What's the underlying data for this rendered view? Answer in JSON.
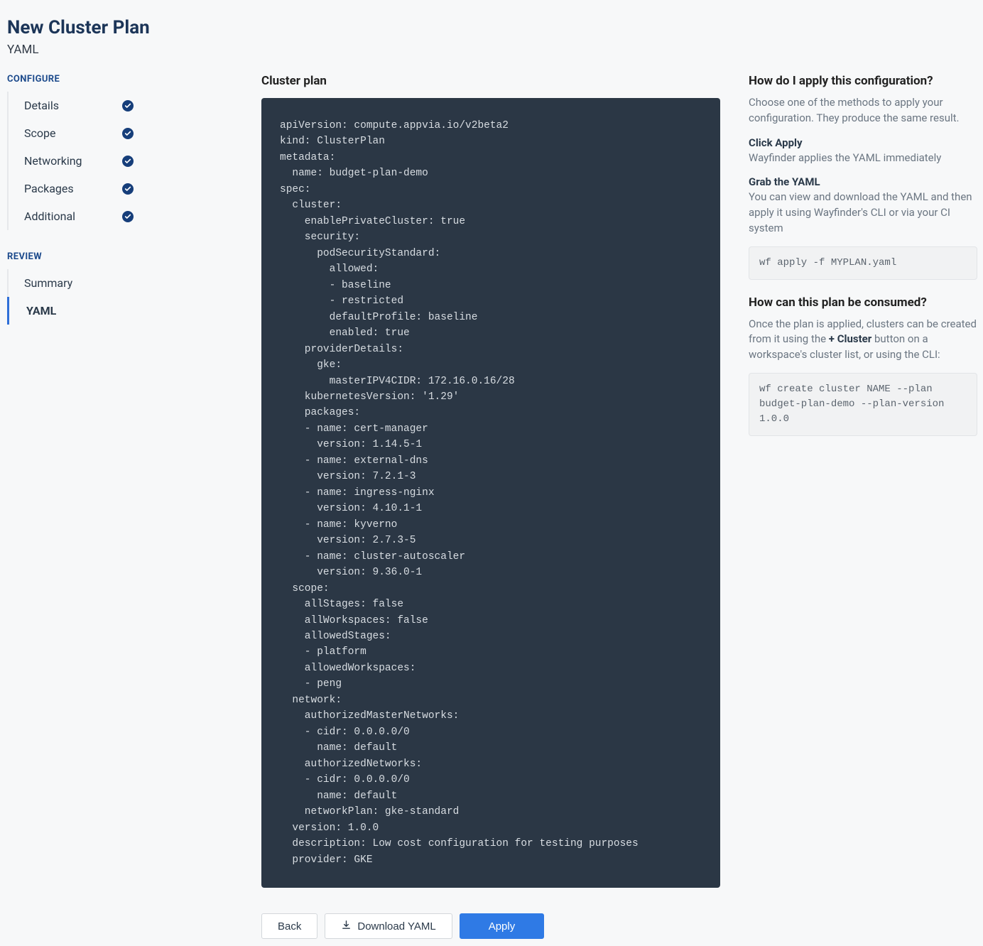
{
  "header": {
    "title": "New Cluster Plan",
    "subtitle": "YAML"
  },
  "sidebar": {
    "configure_label": "CONFIGURE",
    "configure_items": [
      {
        "label": "Details",
        "checked": true
      },
      {
        "label": "Scope",
        "checked": true
      },
      {
        "label": "Networking",
        "checked": true
      },
      {
        "label": "Packages",
        "checked": true
      },
      {
        "label": "Additional",
        "checked": true
      }
    ],
    "review_label": "REVIEW",
    "review_items": [
      {
        "label": "Summary",
        "active": false
      },
      {
        "label": "YAML",
        "active": true
      }
    ]
  },
  "main": {
    "heading": "Cluster plan",
    "yaml": "apiVersion: compute.appvia.io/v2beta2\nkind: ClusterPlan\nmetadata:\n  name: budget-plan-demo\nspec:\n  cluster:\n    enablePrivateCluster: true\n    security:\n      podSecurityStandard:\n        allowed:\n        - baseline\n        - restricted\n        defaultProfile: baseline\n        enabled: true\n    providerDetails:\n      gke:\n        masterIPV4CIDR: 172.16.0.16/28\n    kubernetesVersion: '1.29'\n    packages:\n    - name: cert-manager\n      version: 1.14.5-1\n    - name: external-dns\n      version: 7.2.1-3\n    - name: ingress-nginx\n      version: 4.10.1-1\n    - name: kyverno\n      version: 2.7.3-5\n    - name: cluster-autoscaler\n      version: 9.36.0-1\n  scope:\n    allStages: false\n    allWorkspaces: false\n    allowedStages:\n    - platform\n    allowedWorkspaces:\n    - peng\n  network:\n    authorizedMasterNetworks:\n    - cidr: 0.0.0.0/0\n      name: default\n    authorizedNetworks:\n    - cidr: 0.0.0.0/0\n      name: default\n    networkPlan: gke-standard\n  version: 1.0.0\n  description: Low cost configuration for testing purposes\n  provider: GKE",
    "buttons": {
      "back": "Back",
      "download": "Download YAML",
      "apply": "Apply"
    }
  },
  "aside": {
    "q1_title": "How do I apply this configuration?",
    "q1_text": "Choose one of the methods to apply your configuration. They produce the same result.",
    "click_apply_h": "Click Apply",
    "click_apply_t": "Wayfinder applies the YAML immediately",
    "grab_h": "Grab the YAML",
    "grab_t": "You can view and download the YAML and then apply it using Wayfinder's CLI or via your CI system",
    "cli1": "wf apply -f MYPLAN.yaml",
    "q2_title": "How can this plan be consumed?",
    "q2_text_a": "Once the plan is applied, clusters can be created from it using the ",
    "q2_text_b": "+ Cluster",
    "q2_text_c": " button on a workspace's cluster list, or using the CLI:",
    "cli2": "wf create cluster NAME --plan budget-plan-demo --plan-version 1.0.0"
  }
}
